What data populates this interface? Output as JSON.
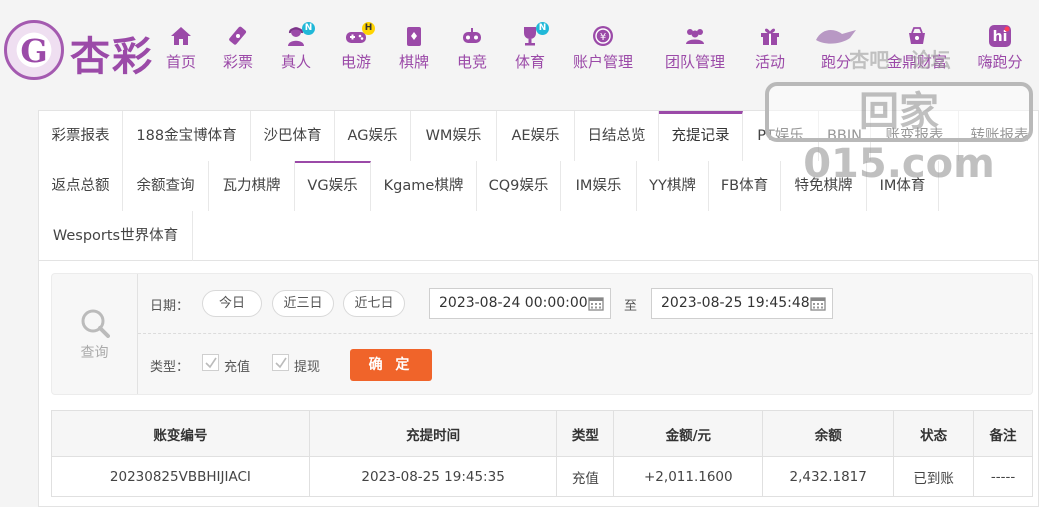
{
  "header": {
    "logo_text": "杏彩",
    "nav": [
      {
        "label": "首页",
        "icon": "home-icon",
        "badge": ""
      },
      {
        "label": "彩票",
        "icon": "lottery-ticket-icon",
        "badge": ""
      },
      {
        "label": "真人",
        "icon": "live-dealer-icon",
        "badge": "N"
      },
      {
        "label": "电游",
        "icon": "gamepad-icon",
        "badge": "H"
      },
      {
        "label": "棋牌",
        "icon": "cards-icon",
        "badge": ""
      },
      {
        "label": "电竞",
        "icon": "esports-controller-icon",
        "badge": ""
      },
      {
        "label": "体育",
        "icon": "trophy-icon",
        "badge": "N"
      },
      {
        "label": "账户管理",
        "icon": "account-coin-icon",
        "badge": ""
      },
      {
        "label": "团队管理",
        "icon": "team-icon",
        "badge": ""
      },
      {
        "label": "活动",
        "icon": "gift-icon",
        "badge": ""
      },
      {
        "label": "跑分",
        "icon": "running-logo-icon",
        "badge": ""
      },
      {
        "label": "金鼎财富",
        "icon": "treasure-icon",
        "badge": ""
      },
      {
        "label": "嗨跑分",
        "icon": "hi-icon",
        "badge": ""
      }
    ]
  },
  "watermark": {
    "text": "回家015.com",
    "top_text": "杏吧 · 论坛"
  },
  "tabs": {
    "row1": [
      "彩票报表",
      "188金宝博体育",
      "沙巴体育",
      "AG娱乐",
      "WM娱乐",
      "AE娱乐",
      "日结总览",
      "充提记录",
      "PT娱乐",
      "BBIN",
      "账变报表",
      "转账报表"
    ],
    "row2": [
      "返点总额",
      "余额查询",
      "瓦力棋牌",
      "VG娱乐",
      "Kgame棋牌",
      "CQ9娱乐",
      "IM娱乐",
      "YY棋牌",
      "FB体育",
      "特免棋牌",
      "IM体育"
    ],
    "row3": [
      "Wesports世界体育"
    ]
  },
  "query": {
    "side_label": "查询",
    "date_label": "日期：",
    "quick": [
      "今日",
      "近三日",
      "近七日"
    ],
    "start": "2023-08-24 00:00:00",
    "to_label": "至",
    "end": "2023-08-25 19:45:48",
    "type_label": "类型：",
    "type_recharge": "充值",
    "type_withdraw": "提现",
    "confirm": "确 定"
  },
  "table": {
    "headers": [
      "账变编号",
      "充提时间",
      "类型",
      "金额/元",
      "余额",
      "状态",
      "备注"
    ],
    "rows": [
      [
        "20230825VBBHIJIACI",
        "2023-08-25 19:45:35",
        "充值",
        "+2,011.1600",
        "2,432.1817",
        "已到账",
        "-----"
      ]
    ]
  },
  "colors": {
    "brand": "#9b4aa8",
    "accent": "#f0642a",
    "amount": "#d3262b",
    "status_ok": "#1f9a24"
  }
}
